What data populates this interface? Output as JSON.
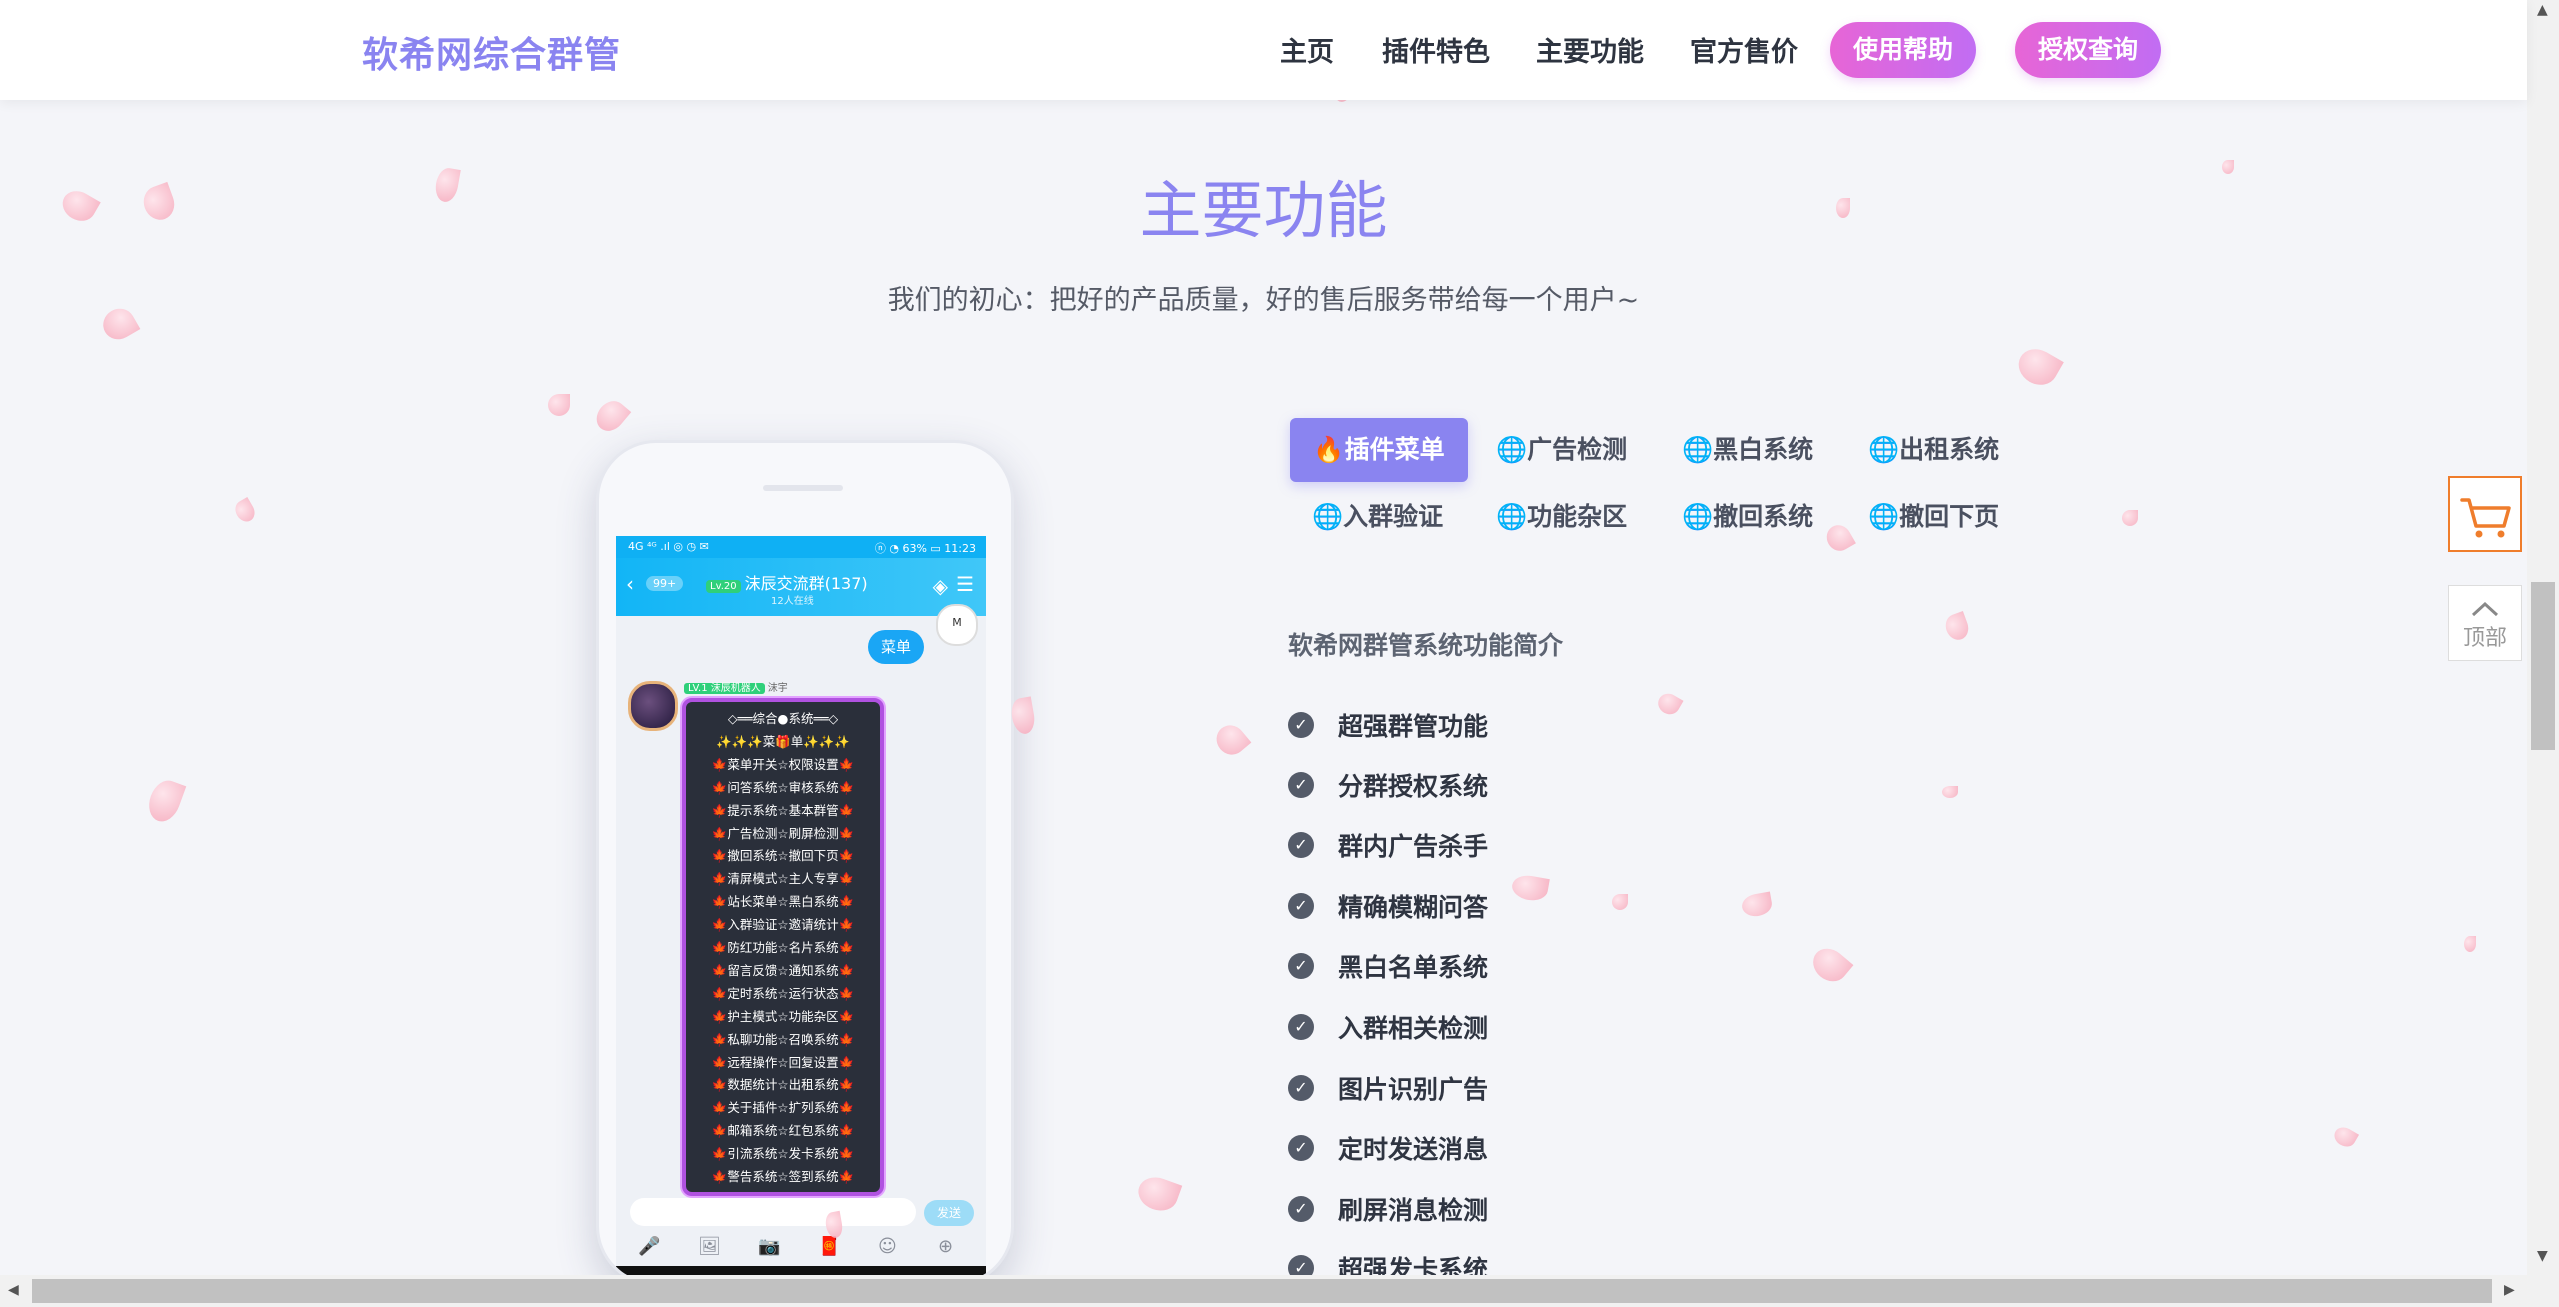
{
  "header": {
    "brand": "软希网综合群管",
    "nav": [
      "主页",
      "插件特色",
      "主要功能",
      "官方售价"
    ],
    "buttons": [
      "使用帮助",
      "授权查询"
    ]
  },
  "section": {
    "title": "主要功能",
    "subtitle": "我们的初心：把好的产品质量，好的售后服务带给每一个用户~"
  },
  "phone": {
    "status_left": "4G ⁴ᴳ .ıl ◎ ◷ ✉",
    "status_right": "ⓝ ◔ 63% ▭ 11:23",
    "back_badge": "99+",
    "group_tag": "Lv.20",
    "group_name": "沫辰交流群(137)",
    "group_sub": "12人在线",
    "my_message": "菜单",
    "my_avatar": "M",
    "bot_tag": "LV.1 沫辰机器人",
    "bot_name": "沫宇",
    "menu_lines": [
      "◇══综合●系统══◇",
      "✨✨✨菜🎁单✨✨✨",
      "🍁菜单开关☆权限设置🍁",
      "🍁问答系统☆审核系统🍁",
      "🍁提示系统☆基本群管🍁",
      "🍁广告检测☆刷屏检测🍁",
      "🍁撤回系统☆撤回下页🍁",
      "🍁清屏模式☆主人专享🍁",
      "🍁站长菜单☆黑白系统🍁",
      "🍁入群验证☆邀请统计🍁",
      "🍁防红功能☆名片系统🍁",
      "🍁留言反馈☆通知系统🍁",
      "🍁定时系统☆运行状态🍁",
      "🍁护主模式☆功能杂区🍁",
      "🍁私聊功能☆召唤系统🍁",
      "🍁远程操作☆回复设置🍁",
      "🍁数据统计☆出租系统🍁",
      "🍁关于插件☆扩列系统🍁",
      "🍁邮箱系统☆红包系统🍁",
      "🍁引流系统☆发卡系统🍁",
      "🍁警告系统☆签到系统🍁"
    ],
    "send_label": "发送",
    "tools": [
      "🎤",
      "🖼",
      "📷",
      "🧧",
      "☺",
      "⊕"
    ]
  },
  "tabs": [
    {
      "label": "插件菜单",
      "icon": "🔥",
      "active": true
    },
    {
      "label": "广告检测",
      "icon": "🌐",
      "active": false
    },
    {
      "label": "黑白系统",
      "icon": "🌐",
      "active": false
    },
    {
      "label": "出租系统",
      "icon": "🌐",
      "active": false
    },
    {
      "label": "入群验证",
      "icon": "🌐",
      "active": false
    },
    {
      "label": "功能杂区",
      "icon": "🌐",
      "active": false
    },
    {
      "label": "撤回系统",
      "icon": "🌐",
      "active": false
    },
    {
      "label": "撤回下页",
      "icon": "🌐",
      "active": false
    }
  ],
  "features": {
    "title": "软希网群管系统功能简介",
    "items": [
      "超强群管功能",
      "分群授权系统",
      "群内广告杀手",
      "精确模糊问答",
      "黑白名单系统",
      "入群相关检测",
      "图片识别广告",
      "定时发送消息",
      "刷屏消息检测",
      "超强发卡系统"
    ],
    "check_icon": "✓"
  },
  "widgets": {
    "totop_label": "顶部"
  },
  "colors": {
    "accent": "#8a84f0",
    "pill": "#e765d6",
    "cart": "#ef7d2c"
  }
}
